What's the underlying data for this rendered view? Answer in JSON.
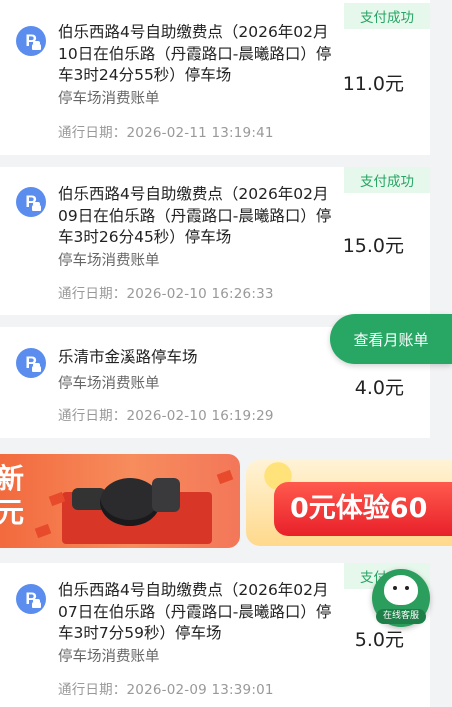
{
  "records": [
    {
      "title": "伯乐西路4号自助缴费点（2026年02月10日在伯乐路（丹霞路口-晨曦路口）停车3时24分55秒）停车场",
      "subtitle": "停车场消费账单",
      "date": "通行日期：2026-02-11 13:19:41",
      "amount": "11.0元",
      "status": "支付成功"
    },
    {
      "title": "伯乐西路4号自助缴费点（2026年02月09日在伯乐路（丹霞路口-晨曦路口）停车3时26分45秒）停车场",
      "subtitle": "停车场消费账单",
      "date": "通行日期：2026-02-10 16:26:33",
      "amount": "15.0元",
      "status": "支付成功"
    },
    {
      "title": "乐清市金溪路停车场",
      "subtitle": "停车场消费账单",
      "date": "通行日期：2026-02-10 16:19:29",
      "amount": "4.0元",
      "status": ""
    },
    {
      "title": "伯乐西路4号自助缴费点（2026年02月07日在伯乐路（丹霞路口-晨曦路口）停车3时7分59秒）停车场",
      "subtitle": "停车场消费账单",
      "date": "通行日期：2026-02-09 13:39:01",
      "amount": "5.0元",
      "status": "支付成功"
    }
  ],
  "icons": {
    "parking": "parking-icon",
    "service": "bear-avatar-icon"
  },
  "parking_icon_letter": "P",
  "banner": {
    "left_text": "新\n元",
    "right_text": "0元体验60"
  },
  "month_bill_button": "查看月账单",
  "customer_service_label": "在线客服",
  "colors": {
    "accent_green": "#27a664",
    "badge_bg": "#e6f7ec",
    "parking_blue": "#5b8def"
  }
}
